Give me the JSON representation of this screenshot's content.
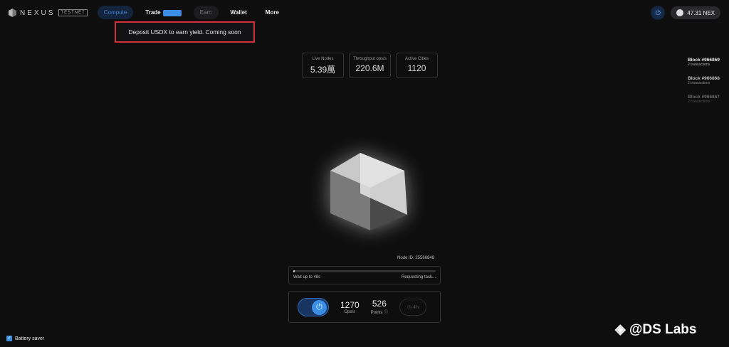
{
  "header": {
    "brand": "NEXUS",
    "network_badge": "TESTNET",
    "nav": [
      {
        "label": "Compute"
      },
      {
        "label": "Trade"
      },
      {
        "label": "Earn"
      },
      {
        "label": "Wallet"
      },
      {
        "label": "More"
      }
    ],
    "balance": "47.31 NEX"
  },
  "tooltip": "Deposit USDX to earn yield. Coming soon",
  "stats": [
    {
      "label": "Live Nodes",
      "value": "5.39萬"
    },
    {
      "label": "Throughput ops/s",
      "value": "220.6M"
    },
    {
      "label": "Active Cities",
      "value": "1120"
    }
  ],
  "blocks": [
    {
      "title": "Block #966869",
      "sub": "2 transactions"
    },
    {
      "title": "Block #966868",
      "sub": "2 transactions"
    },
    {
      "title": "Block #966867",
      "sub": "2 transactions"
    }
  ],
  "node": {
    "id_label": "Node ID: 25566848",
    "progress": 0.01,
    "wait": "Wait up to 48s",
    "status": "Requesting task...",
    "ops": "1270",
    "ops_label": "Ops/s",
    "points": "526",
    "points_label": "Points ⓘ",
    "timer": "◷ 4h"
  },
  "battery_saver": "Battery saver",
  "watermark": "◈ @DS Labs"
}
